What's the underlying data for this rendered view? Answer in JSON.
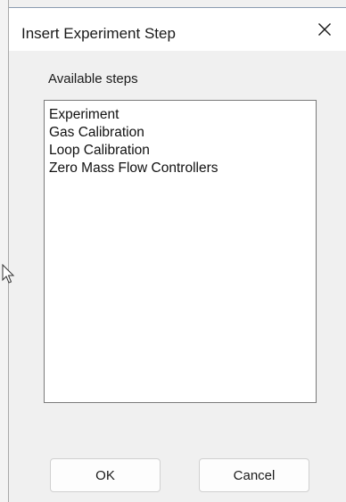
{
  "dialog": {
    "title": "Insert Experiment Step",
    "close_icon": "close-icon"
  },
  "list": {
    "label": "Available steps",
    "items": [
      "Experiment",
      "Gas Calibration",
      "Loop Calibration",
      "Zero Mass Flow Controllers"
    ]
  },
  "buttons": {
    "ok_label": "OK",
    "cancel_label": "Cancel"
  },
  "cursor_icon": "mouse-cursor-icon"
}
